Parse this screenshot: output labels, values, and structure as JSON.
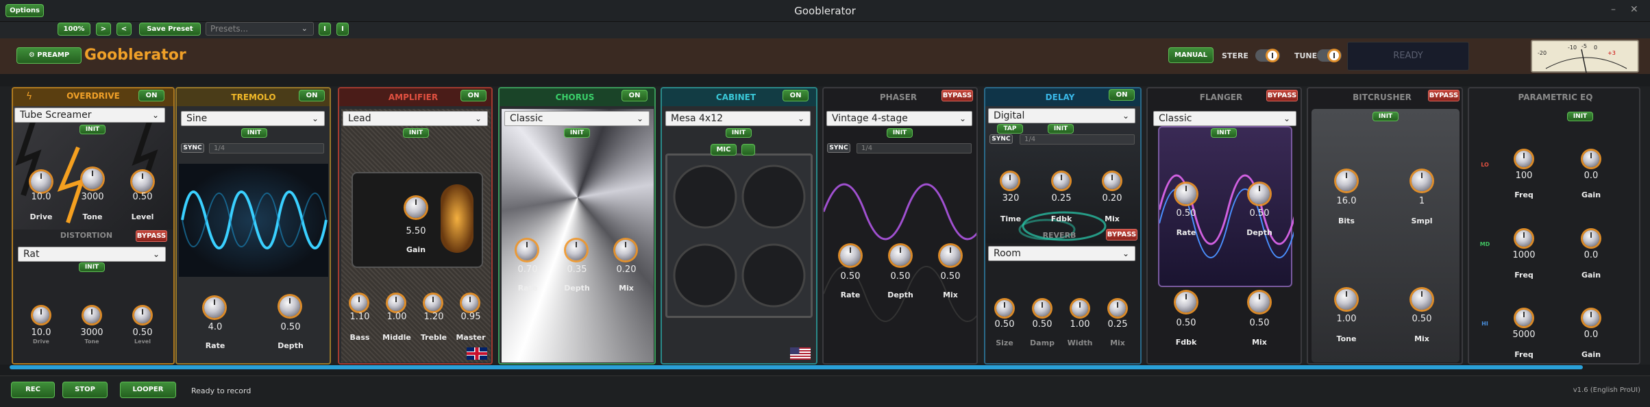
{
  "window": {
    "title": "Gooblerator",
    "minimize": "–",
    "close": "✕"
  },
  "toolbar": {
    "options_label": "Options",
    "zoom": "100%",
    "nav_next": ">",
    "nav_prev": "<",
    "save_preset": "Save Preset",
    "presets_placeholder": "Presets...",
    "mini_btn_1": "I",
    "mini_btn_2": "I"
  },
  "header": {
    "preamp_label": "PREAMP",
    "brand": "Gooblerator",
    "manual_label": "MANUAL",
    "stereo_label": "STERE",
    "tune_label": "TUNE",
    "ready_text": "READY",
    "vu_scale": [
      "-20",
      "-10",
      "-5",
      "0",
      "+3"
    ]
  },
  "modules": {
    "overdrive": {
      "title": "OVERDRIVE",
      "state": "ON",
      "preset": "Tube Screamer",
      "init": "INIT",
      "knobs": [
        {
          "label": "Drive",
          "value": "10.0"
        },
        {
          "label": "Tone",
          "value": "3000"
        },
        {
          "label": "Level",
          "value": "0.50"
        }
      ]
    },
    "distortion": {
      "title": "DISTORTION",
      "state": "BYPASS",
      "preset": "Rat",
      "init": "INIT",
      "knobs": [
        {
          "label": "Drive",
          "value": "10.0"
        },
        {
          "label": "Tone",
          "value": "3000"
        },
        {
          "label": "Level",
          "value": "0.50"
        }
      ]
    },
    "tremolo": {
      "title": "TREMOLO",
      "state": "ON",
      "preset": "Sine",
      "init": "INIT",
      "sync": "SYNC",
      "division": "1/4",
      "knobs": [
        {
          "label": "Rate",
          "value": "4.0"
        },
        {
          "label": "Depth",
          "value": "0.50"
        }
      ]
    },
    "amplifier": {
      "title": "AMPLIFIER",
      "state": "ON",
      "preset": "Lead",
      "init": "INIT",
      "gain": {
        "label": "Gain",
        "value": "5.50"
      },
      "knobs": [
        {
          "label": "Bass",
          "value": "1.10"
        },
        {
          "label": "Middle",
          "value": "1.00"
        },
        {
          "label": "Treble",
          "value": "1.20"
        },
        {
          "label": "Master",
          "value": "0.95"
        }
      ]
    },
    "chorus": {
      "title": "CHORUS",
      "state": "ON",
      "preset": "Classic",
      "init": "INIT",
      "knobs": [
        {
          "label": "Rate",
          "value": "0.70"
        },
        {
          "label": "Depth",
          "value": "0.35"
        },
        {
          "label": "Mix",
          "value": "0.20"
        }
      ]
    },
    "cabinet": {
      "title": "CABINET",
      "state": "ON",
      "preset": "Mesa 4x12",
      "init": "INIT",
      "mic": "MIC"
    },
    "phaser": {
      "title": "PHASER",
      "state": "BYPASS",
      "preset": "Vintage 4-stage",
      "init": "INIT",
      "sync": "SYNC",
      "division": "1/4",
      "knobs": [
        {
          "label": "Rate",
          "value": "0.50"
        },
        {
          "label": "Depth",
          "value": "0.50"
        },
        {
          "label": "Mix",
          "value": "0.50"
        }
      ]
    },
    "delay": {
      "title": "DELAY",
      "state": "ON",
      "preset": "Digital",
      "tap": "TAP",
      "init": "INIT",
      "sync": "SYNC",
      "division": "1/4",
      "knobs": [
        {
          "label": "Time",
          "value": "320"
        },
        {
          "label": "Fdbk",
          "value": "0.25"
        },
        {
          "label": "Mix",
          "value": "0.20"
        }
      ]
    },
    "reverb": {
      "title": "REVERB",
      "state": "BYPASS",
      "preset": "Room",
      "knobs": [
        {
          "label": "Size",
          "value": "0.50"
        },
        {
          "label": "Damp",
          "value": "0.50"
        },
        {
          "label": "Width",
          "value": "1.00"
        },
        {
          "label": "Mix",
          "value": "0.25"
        }
      ]
    },
    "flanger": {
      "title": "FLANGER",
      "state": "BYPASS",
      "preset": "Classic",
      "init": "INIT",
      "knobs": [
        {
          "label": "Rate",
          "value": "0.50"
        },
        {
          "label": "Depth",
          "value": "0.50"
        },
        {
          "label": "Fdbk",
          "value": "0.50"
        },
        {
          "label": "Mix",
          "value": "0.50"
        }
      ]
    },
    "bitcrusher": {
      "title": "BITCRUSHER",
      "state": "BYPASS",
      "init": "INIT",
      "knobs": [
        {
          "label": "Bits",
          "value": "16.0"
        },
        {
          "label": "Smpl",
          "value": "1"
        },
        {
          "label": "Tone",
          "value": "1.00"
        },
        {
          "label": "Mix",
          "value": "0.50"
        }
      ]
    },
    "eq": {
      "title": "PARAMETRIC EQ",
      "init": "INIT",
      "bands": [
        {
          "band": "LO",
          "freq": "100",
          "gain": "0.0"
        },
        {
          "band": "MD",
          "freq": "1000",
          "gain": "0.0"
        },
        {
          "band": "HI",
          "freq": "5000",
          "gain": "0.0"
        }
      ],
      "freq_label": "Freq",
      "gain_label": "Gain"
    }
  },
  "footer": {
    "rec": "REC",
    "stop": "STOP",
    "looper": "LOOPER",
    "status": "Ready to record",
    "version": "v1.6 (English ProUI)"
  },
  "colors": {
    "accent": "#f0a028",
    "green": "#3f8f3a",
    "bypass": "#c5453a",
    "cyan": "#2aa0d8"
  }
}
